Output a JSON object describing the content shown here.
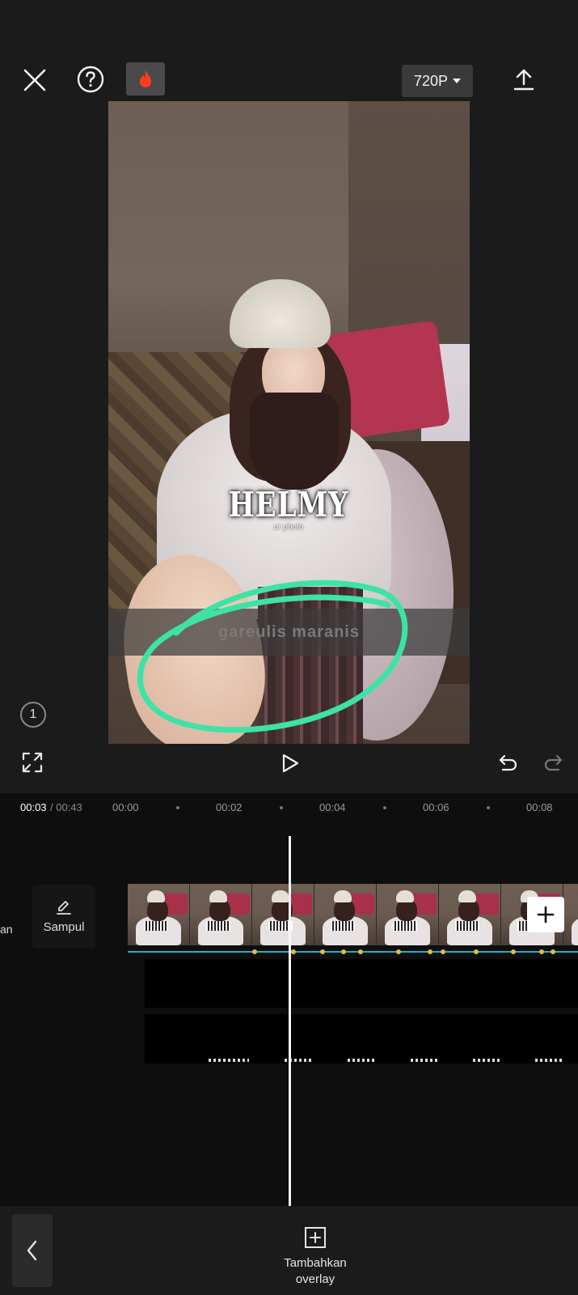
{
  "toolbar": {
    "resolution": "720P"
  },
  "preview": {
    "logo_main": "HELMY",
    "logo_sub": "ur photo",
    "caption": "gareulis maranis",
    "clip_count_badge": "1"
  },
  "timeline": {
    "current_time": "00:03",
    "total_time": "/ 00:43",
    "ticks": [
      "00:00",
      "00:02",
      "00:04",
      "00:06",
      "00:08"
    ],
    "side_label": "an",
    "cover_label": "Sampul"
  },
  "bottom": {
    "overlay_label_line1": "Tambahkan",
    "overlay_label_line2": "overlay"
  },
  "colors": {
    "annotation": "#3de3a5",
    "track_line": "#1bb3c9",
    "keyframe": "#e6b84a",
    "fire": "#ff3b1f"
  },
  "icons": [
    "close-icon",
    "help-icon",
    "fire-icon",
    "caret-down-icon",
    "export-icon",
    "fullscreen-icon",
    "play-icon",
    "undo-icon",
    "redo-icon",
    "edit-icon",
    "plus-icon",
    "chevron-left-icon",
    "add-overlay-icon"
  ]
}
